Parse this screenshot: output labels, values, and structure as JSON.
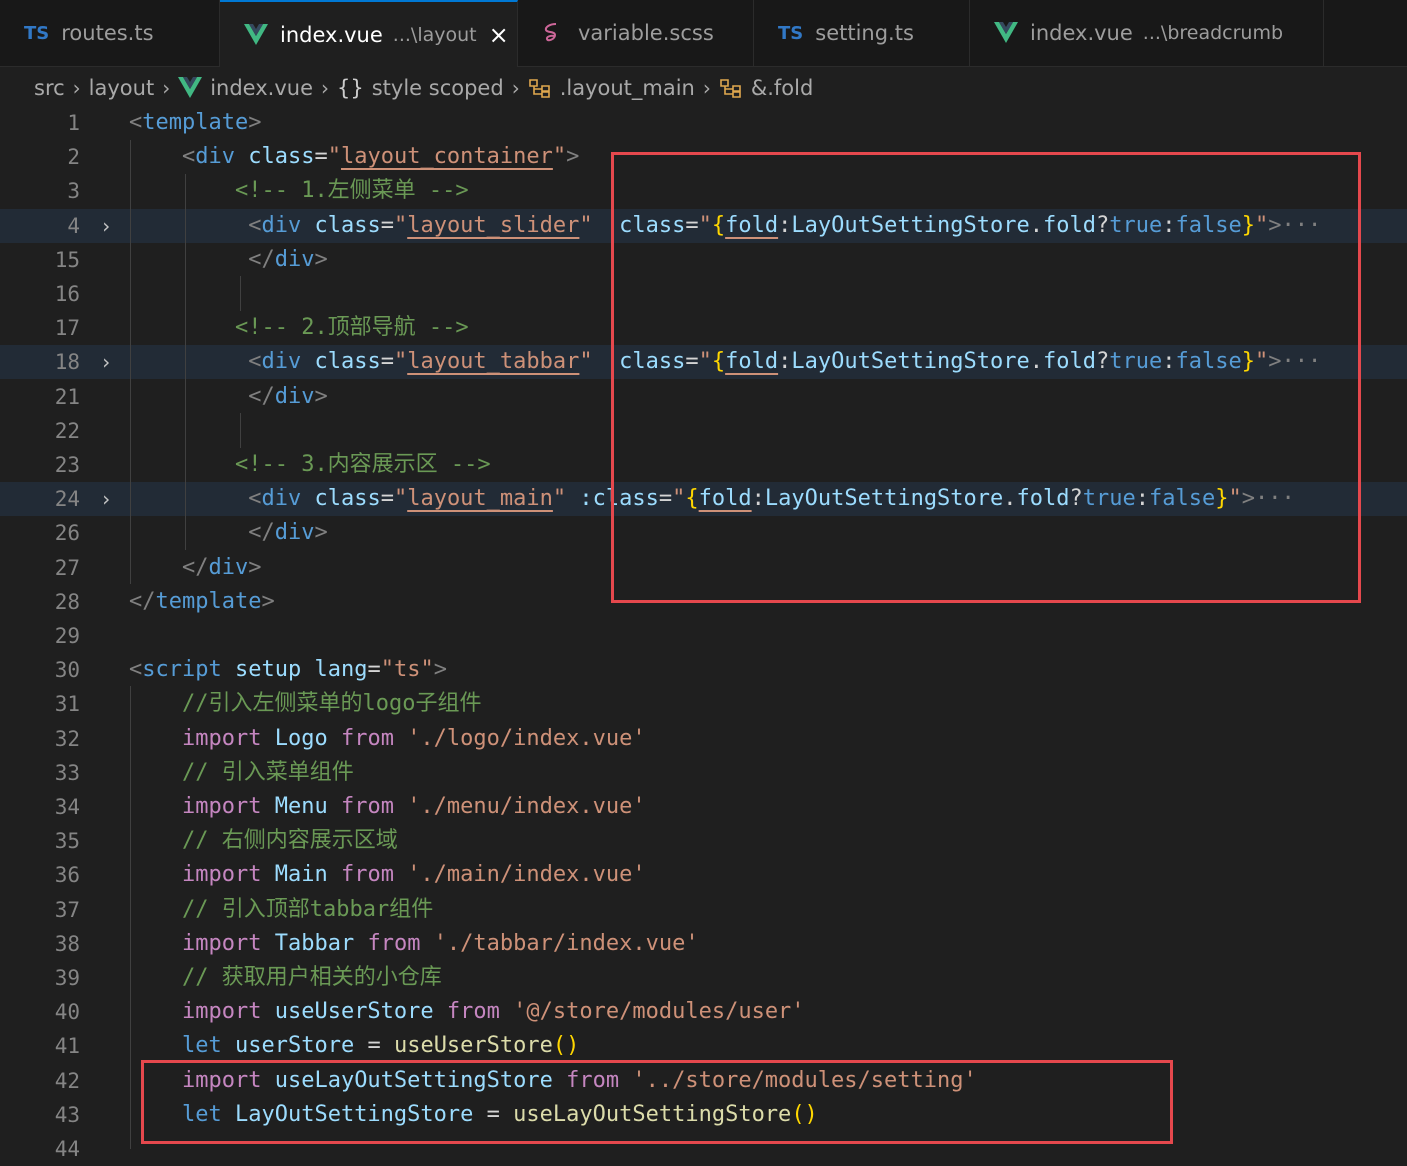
{
  "tabs": [
    {
      "icon": "typescript-icon",
      "icon_text": "TS",
      "name": "routes.ts",
      "desc": "",
      "active": false
    },
    {
      "icon": "vue-icon",
      "icon_text": "",
      "name": "index.vue",
      "desc": "...\\layout",
      "active": true,
      "close": "×"
    },
    {
      "icon": "sass-icon",
      "icon_text": "",
      "name": "variable.scss",
      "desc": "",
      "active": false
    },
    {
      "icon": "typescript-icon",
      "icon_text": "TS",
      "name": "setting.ts",
      "desc": "",
      "active": false
    },
    {
      "icon": "vue-icon",
      "icon_text": "",
      "name": "index.vue",
      "desc": "...\\breadcrumb",
      "active": false
    }
  ],
  "breadcrumb": {
    "items": [
      "src",
      "layout",
      "index.vue",
      "style scoped",
      ".layout_main",
      "&.fold"
    ],
    "braces": "{}"
  },
  "editor": {
    "lines": [
      {
        "n": "1",
        "fold": "",
        "hl": false,
        "code": [
          [
            "c-br",
            "<"
          ],
          [
            "c-tag",
            "template"
          ],
          [
            "c-br",
            ">"
          ]
        ]
      },
      {
        "n": "2",
        "fold": "",
        "hl": false,
        "code": [
          [
            "c-white",
            "    "
          ],
          [
            "c-br",
            "<"
          ],
          [
            "c-tag",
            "div"
          ],
          [
            "c-white",
            " "
          ],
          [
            "c-attr",
            "class"
          ],
          [
            "c-white",
            "="
          ],
          [
            "c-str",
            "\""
          ],
          [
            "c-str u",
            "layout_container"
          ],
          [
            "c-str",
            "\""
          ],
          [
            "c-br",
            ">"
          ]
        ]
      },
      {
        "n": "3",
        "fold": "",
        "hl": false,
        "code": [
          [
            "c-white",
            "        "
          ],
          [
            "c-cm",
            "<!-- 1.左侧菜单 -->"
          ]
        ]
      },
      {
        "n": "4",
        "fold": "›",
        "hl": true,
        "code": [
          [
            "c-white",
            "         "
          ],
          [
            "c-br",
            "<"
          ],
          [
            "c-tag",
            "div"
          ],
          [
            "c-white",
            " "
          ],
          [
            "c-attr",
            "class"
          ],
          [
            "c-white",
            "="
          ],
          [
            "c-str",
            "\""
          ],
          [
            "c-str u",
            "layout_slider"
          ],
          [
            "c-str",
            "\""
          ],
          [
            "c-white",
            " "
          ],
          [
            "c-attr",
            ":class"
          ],
          [
            "c-white",
            "="
          ],
          [
            "c-str",
            "\""
          ],
          [
            "c-p1",
            "{"
          ],
          [
            "c-var u",
            "fold"
          ],
          [
            "c-white",
            ":"
          ],
          [
            "c-var",
            "LayOutSettingStore"
          ],
          [
            "c-white",
            "."
          ],
          [
            "c-var",
            "fold"
          ],
          [
            "c-white",
            "?"
          ],
          [
            "c-kw2",
            "true"
          ],
          [
            "c-white",
            ":"
          ],
          [
            "c-kw2",
            "false"
          ],
          [
            "c-p1",
            "}"
          ],
          [
            "c-str",
            "\""
          ],
          [
            "c-br",
            ">"
          ],
          [
            "c-br",
            "···"
          ]
        ]
      },
      {
        "n": "15",
        "fold": "",
        "hl": false,
        "code": [
          [
            "c-white",
            "         "
          ],
          [
            "c-br",
            "</"
          ],
          [
            "c-tag",
            "div"
          ],
          [
            "c-br",
            ">"
          ]
        ]
      },
      {
        "n": "16",
        "fold": "",
        "hl": false,
        "code": []
      },
      {
        "n": "17",
        "fold": "",
        "hl": false,
        "code": [
          [
            "c-white",
            "        "
          ],
          [
            "c-cm",
            "<!-- 2.顶部导航 -->"
          ]
        ]
      },
      {
        "n": "18",
        "fold": "›",
        "hl": true,
        "code": [
          [
            "c-white",
            "         "
          ],
          [
            "c-br",
            "<"
          ],
          [
            "c-tag",
            "div"
          ],
          [
            "c-white",
            " "
          ],
          [
            "c-attr",
            "class"
          ],
          [
            "c-white",
            "="
          ],
          [
            "c-str",
            "\""
          ],
          [
            "c-str u",
            "layout_tabbar"
          ],
          [
            "c-str",
            "\""
          ],
          [
            "c-white",
            " "
          ],
          [
            "c-attr",
            ":class"
          ],
          [
            "c-white",
            "="
          ],
          [
            "c-str",
            "\""
          ],
          [
            "c-p1",
            "{"
          ],
          [
            "c-var u",
            "fold"
          ],
          [
            "c-white",
            ":"
          ],
          [
            "c-var",
            "LayOutSettingStore"
          ],
          [
            "c-white",
            "."
          ],
          [
            "c-var",
            "fold"
          ],
          [
            "c-white",
            "?"
          ],
          [
            "c-kw2",
            "true"
          ],
          [
            "c-white",
            ":"
          ],
          [
            "c-kw2",
            "false"
          ],
          [
            "c-p1",
            "}"
          ],
          [
            "c-str",
            "\""
          ],
          [
            "c-br",
            ">"
          ],
          [
            "c-br",
            "···"
          ]
        ]
      },
      {
        "n": "21",
        "fold": "",
        "hl": false,
        "code": [
          [
            "c-white",
            "         "
          ],
          [
            "c-br",
            "</"
          ],
          [
            "c-tag",
            "div"
          ],
          [
            "c-br",
            ">"
          ]
        ]
      },
      {
        "n": "22",
        "fold": "",
        "hl": false,
        "code": []
      },
      {
        "n": "23",
        "fold": "",
        "hl": false,
        "code": [
          [
            "c-white",
            "        "
          ],
          [
            "c-cm",
            "<!-- 3.内容展示区 -->"
          ]
        ]
      },
      {
        "n": "24",
        "fold": "›",
        "hl": true,
        "code": [
          [
            "c-white",
            "         "
          ],
          [
            "c-br",
            "<"
          ],
          [
            "c-tag",
            "div"
          ],
          [
            "c-white",
            " "
          ],
          [
            "c-attr",
            "class"
          ],
          [
            "c-white",
            "="
          ],
          [
            "c-str",
            "\""
          ],
          [
            "c-str u",
            "layout_main"
          ],
          [
            "c-str",
            "\""
          ],
          [
            "c-white",
            " "
          ],
          [
            "c-attr",
            ":class"
          ],
          [
            "c-white",
            "="
          ],
          [
            "c-str",
            "\""
          ],
          [
            "c-p1",
            "{"
          ],
          [
            "c-var u",
            "fold"
          ],
          [
            "c-white",
            ":"
          ],
          [
            "c-var",
            "LayOutSettingStore"
          ],
          [
            "c-white",
            "."
          ],
          [
            "c-var",
            "fold"
          ],
          [
            "c-white",
            "?"
          ],
          [
            "c-kw2",
            "true"
          ],
          [
            "c-white",
            ":"
          ],
          [
            "c-kw2",
            "false"
          ],
          [
            "c-p1",
            "}"
          ],
          [
            "c-str",
            "\""
          ],
          [
            "c-br",
            ">"
          ],
          [
            "c-br",
            "···"
          ]
        ]
      },
      {
        "n": "26",
        "fold": "",
        "hl": false,
        "code": [
          [
            "c-white",
            "         "
          ],
          [
            "c-br",
            "</"
          ],
          [
            "c-tag",
            "div"
          ],
          [
            "c-br",
            ">"
          ]
        ]
      },
      {
        "n": "27",
        "fold": "",
        "hl": false,
        "code": [
          [
            "c-white",
            "    "
          ],
          [
            "c-br",
            "</"
          ],
          [
            "c-tag",
            "div"
          ],
          [
            "c-br",
            ">"
          ]
        ]
      },
      {
        "n": "28",
        "fold": "",
        "hl": false,
        "code": [
          [
            "c-br",
            "</"
          ],
          [
            "c-tag",
            "template"
          ],
          [
            "c-br",
            ">"
          ]
        ]
      },
      {
        "n": "29",
        "fold": "",
        "hl": false,
        "code": []
      },
      {
        "n": "30",
        "fold": "",
        "hl": false,
        "code": [
          [
            "c-br",
            "<"
          ],
          [
            "c-tag",
            "script"
          ],
          [
            "c-white",
            " "
          ],
          [
            "c-attr",
            "setup"
          ],
          [
            "c-white",
            " "
          ],
          [
            "c-attr",
            "lang"
          ],
          [
            "c-white",
            "="
          ],
          [
            "c-str",
            "\"ts\""
          ],
          [
            "c-br",
            ">"
          ]
        ]
      },
      {
        "n": "31",
        "fold": "",
        "hl": false,
        "code": [
          [
            "c-white",
            "    "
          ],
          [
            "c-cm",
            "//引入左侧菜单的logo子组件"
          ]
        ]
      },
      {
        "n": "32",
        "fold": "",
        "hl": false,
        "code": [
          [
            "c-white",
            "    "
          ],
          [
            "c-kw",
            "import"
          ],
          [
            "c-white",
            " "
          ],
          [
            "c-var",
            "Logo"
          ],
          [
            "c-white",
            " "
          ],
          [
            "c-kw",
            "from"
          ],
          [
            "c-white",
            " "
          ],
          [
            "c-str",
            "'./logo/index.vue'"
          ]
        ]
      },
      {
        "n": "33",
        "fold": "",
        "hl": false,
        "code": [
          [
            "c-white",
            "    "
          ],
          [
            "c-cm",
            "// 引入菜单组件"
          ]
        ]
      },
      {
        "n": "34",
        "fold": "",
        "hl": false,
        "code": [
          [
            "c-white",
            "    "
          ],
          [
            "c-kw",
            "import"
          ],
          [
            "c-white",
            " "
          ],
          [
            "c-var",
            "Menu"
          ],
          [
            "c-white",
            " "
          ],
          [
            "c-kw",
            "from"
          ],
          [
            "c-white",
            " "
          ],
          [
            "c-str",
            "'./menu/index.vue'"
          ]
        ]
      },
      {
        "n": "35",
        "fold": "",
        "hl": false,
        "code": [
          [
            "c-white",
            "    "
          ],
          [
            "c-cm",
            "// 右侧内容展示区域"
          ]
        ]
      },
      {
        "n": "36",
        "fold": "",
        "hl": false,
        "code": [
          [
            "c-white",
            "    "
          ],
          [
            "c-kw",
            "import"
          ],
          [
            "c-white",
            " "
          ],
          [
            "c-var",
            "Main"
          ],
          [
            "c-white",
            " "
          ],
          [
            "c-kw",
            "from"
          ],
          [
            "c-white",
            " "
          ],
          [
            "c-str",
            "'./main/index.vue'"
          ]
        ]
      },
      {
        "n": "37",
        "fold": "",
        "hl": false,
        "code": [
          [
            "c-white",
            "    "
          ],
          [
            "c-cm",
            "// 引入顶部tabbar组件"
          ]
        ]
      },
      {
        "n": "38",
        "fold": "",
        "hl": false,
        "code": [
          [
            "c-white",
            "    "
          ],
          [
            "c-kw",
            "import"
          ],
          [
            "c-white",
            " "
          ],
          [
            "c-var",
            "Tabbar"
          ],
          [
            "c-white",
            " "
          ],
          [
            "c-kw",
            "from"
          ],
          [
            "c-white",
            " "
          ],
          [
            "c-str",
            "'./tabbar/index.vue'"
          ]
        ]
      },
      {
        "n": "39",
        "fold": "",
        "hl": false,
        "code": [
          [
            "c-white",
            "    "
          ],
          [
            "c-cm",
            "// 获取用户相关的小仓库"
          ]
        ]
      },
      {
        "n": "40",
        "fold": "",
        "hl": false,
        "code": [
          [
            "c-white",
            "    "
          ],
          [
            "c-kw",
            "import"
          ],
          [
            "c-white",
            " "
          ],
          [
            "c-var",
            "useUserStore"
          ],
          [
            "c-white",
            " "
          ],
          [
            "c-kw",
            "from"
          ],
          [
            "c-white",
            " "
          ],
          [
            "c-str",
            "'@/store/modules/user'"
          ]
        ]
      },
      {
        "n": "41",
        "fold": "",
        "hl": false,
        "code": [
          [
            "c-white",
            "    "
          ],
          [
            "c-kw2",
            "let"
          ],
          [
            "c-white",
            " "
          ],
          [
            "c-var",
            "userStore"
          ],
          [
            "c-white",
            " = "
          ],
          [
            "c-fn",
            "useUserStore"
          ],
          [
            "c-p1",
            "()"
          ]
        ]
      },
      {
        "n": "42",
        "fold": "",
        "hl": false,
        "code": [
          [
            "c-white",
            "    "
          ],
          [
            "c-kw",
            "import"
          ],
          [
            "c-white",
            " "
          ],
          [
            "c-var",
            "useLayOutSettingStore"
          ],
          [
            "c-white",
            " "
          ],
          [
            "c-kw",
            "from"
          ],
          [
            "c-white",
            " "
          ],
          [
            "c-str",
            "'../store/modules/setting'"
          ]
        ]
      },
      {
        "n": "43",
        "fold": "",
        "hl": false,
        "code": [
          [
            "c-white",
            "    "
          ],
          [
            "c-kw2",
            "let"
          ],
          [
            "c-white",
            " "
          ],
          [
            "c-var",
            "LayOutSettingStore"
          ],
          [
            "c-white",
            " = "
          ],
          [
            "c-fn",
            "useLayOutSettingStore"
          ],
          [
            "c-p1",
            "()"
          ]
        ]
      },
      {
        "n": "44",
        "fold": "",
        "hl": false,
        "code": []
      }
    ]
  },
  "annotations": [
    {
      "name": "highlight-box-class-bindings",
      "color": "#e5484d"
    },
    {
      "name": "highlight-box-setting-store",
      "color": "#e5484d"
    }
  ]
}
